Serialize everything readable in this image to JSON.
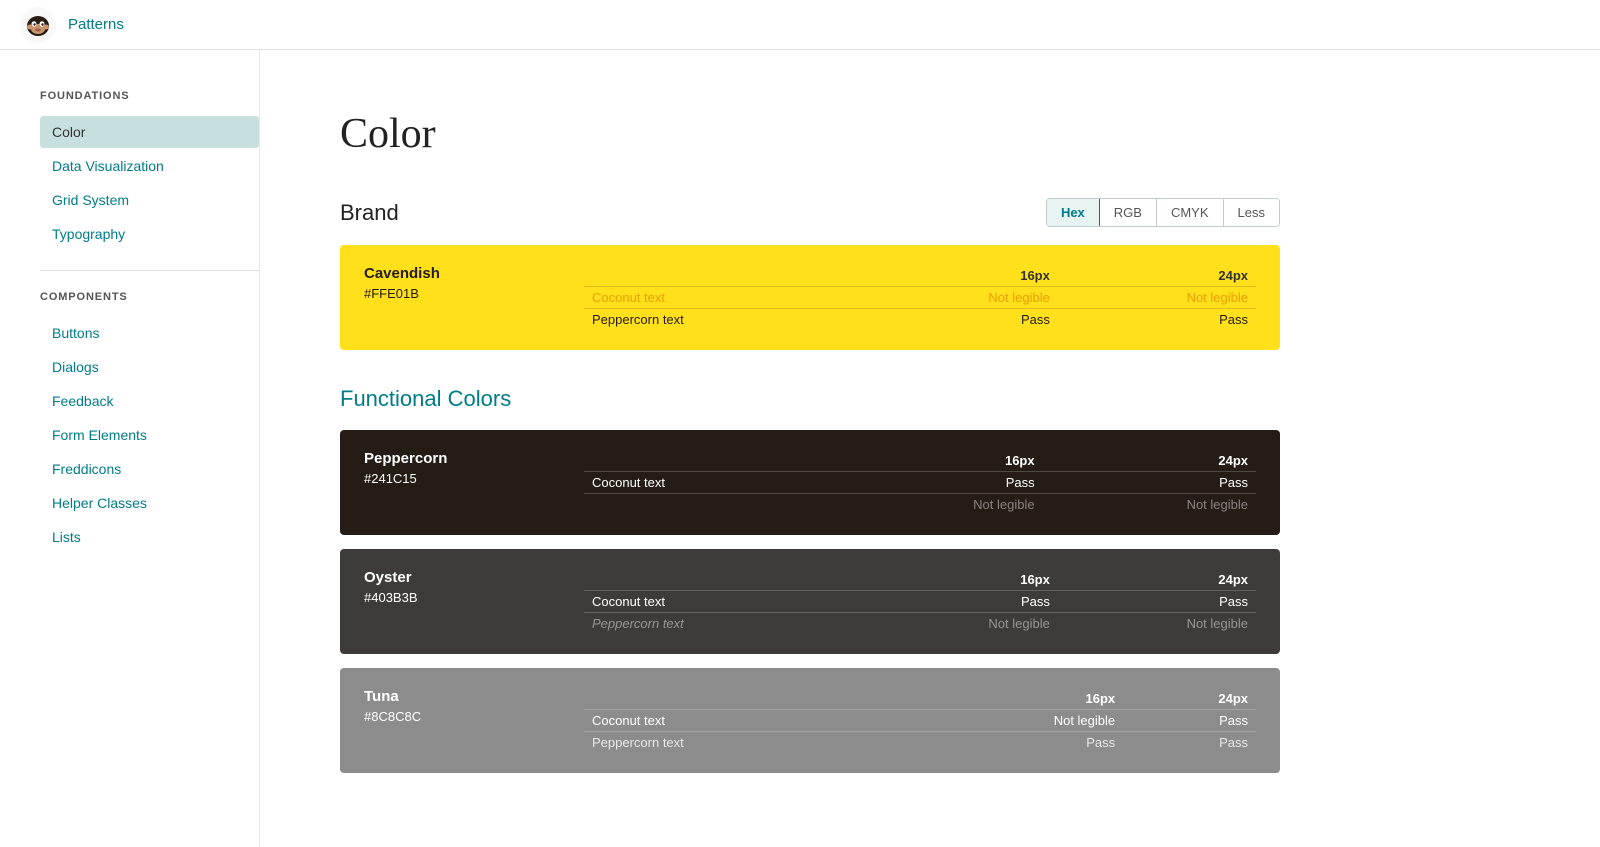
{
  "header": {
    "brand": "Patterns"
  },
  "sidebar": {
    "foundations_label": "FOUNDATIONS",
    "foundations_items": [
      {
        "id": "color",
        "label": "Color",
        "active": true
      },
      {
        "id": "data-visualization",
        "label": "Data Visualization",
        "active": false
      },
      {
        "id": "grid-system",
        "label": "Grid System",
        "active": false
      },
      {
        "id": "typography",
        "label": "Typography",
        "active": false
      }
    ],
    "components_label": "COMPONENTS",
    "components_items": [
      {
        "id": "buttons",
        "label": "Buttons",
        "active": false
      },
      {
        "id": "dialogs",
        "label": "Dialogs",
        "active": false
      },
      {
        "id": "feedback",
        "label": "Feedback",
        "active": false
      },
      {
        "id": "form-elements",
        "label": "Form Elements",
        "active": false
      },
      {
        "id": "freddicons",
        "label": "Freddicons",
        "active": false
      },
      {
        "id": "helper-classes",
        "label": "Helper Classes",
        "active": false
      },
      {
        "id": "lists",
        "label": "Lists",
        "active": false
      }
    ]
  },
  "main": {
    "page_title": "Color",
    "brand_section_title": "Brand",
    "functional_section_title": "Functional Colors",
    "format_buttons": [
      "Hex",
      "RGB",
      "CMYK",
      "Less"
    ],
    "active_format": "Hex",
    "brand_colors": [
      {
        "id": "cavendish",
        "name": "Cavendish",
        "hex": "#FFE01B",
        "bg": "#FFE01B",
        "card_class": "card-cavendish",
        "rows": [
          {
            "label": "",
            "col1": "16px",
            "col2": "24px",
            "header": true
          },
          {
            "label": "Coconut text",
            "col1": "Not legible",
            "col2": "Not legible",
            "row_class": "coconut-row"
          },
          {
            "label": "Peppercorn text",
            "col1": "Pass",
            "col2": "Pass",
            "row_class": "peppercorn-row"
          }
        ]
      }
    ],
    "functional_colors": [
      {
        "id": "peppercorn",
        "name": "Peppercorn",
        "hex": "#241C15",
        "bg": "#241C15",
        "card_class": "card-peppercorn",
        "rows": [
          {
            "label": "",
            "col1": "16px",
            "col2": "24px",
            "header": true
          },
          {
            "label": "Coconut text",
            "col1": "Pass",
            "col2": "Pass",
            "row_class": "coconut-row"
          },
          {
            "label": "",
            "col1": "Not legible",
            "col2": "Not legible",
            "row_class": "row2nd"
          }
        ]
      },
      {
        "id": "oyster",
        "name": "Oyster",
        "hex": "#403B3B",
        "bg": "#403B3B",
        "card_class": "card-oyster",
        "rows": [
          {
            "label": "",
            "col1": "16px",
            "col2": "24px",
            "header": true
          },
          {
            "label": "Coconut text",
            "col1": "Pass",
            "col2": "Pass",
            "row_class": "coconut-row"
          },
          {
            "label": "Peppercorn text",
            "col1": "Not legible",
            "col2": "Not legible",
            "row_class": "row2nd"
          }
        ]
      },
      {
        "id": "tuna",
        "name": "Tuna",
        "hex": "#8C8C8C",
        "bg": "#8C8C8C",
        "card_class": "card-tuna",
        "rows": [
          {
            "label": "",
            "col1": "16px",
            "col2": "24px",
            "header": true
          },
          {
            "label": "Coconut text",
            "col1": "Not legible",
            "col2": "Pass",
            "row_class": "coconut-row"
          },
          {
            "label": "Peppercorn text",
            "col1": "Pass",
            "col2": "Pass",
            "row_class": "peppercorn-row"
          }
        ]
      }
    ]
  }
}
